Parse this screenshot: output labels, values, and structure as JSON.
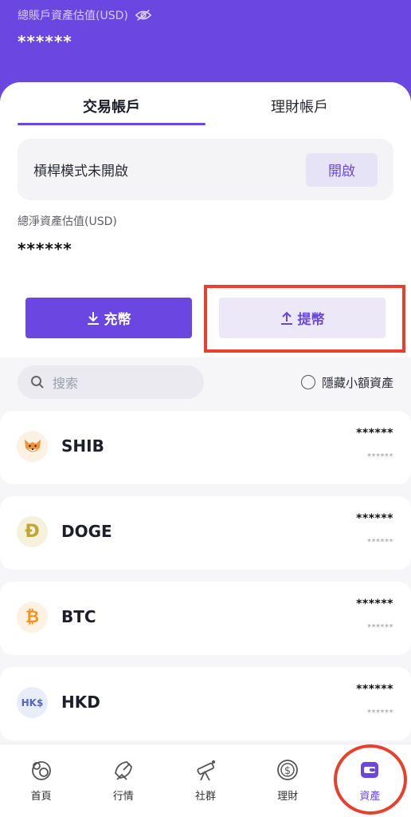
{
  "header": {
    "total_label": "總賬戶資產估值(USD)",
    "total_value": "******",
    "eye_icon": "eye-slash-icon"
  },
  "tabs": [
    {
      "label": "交易帳戶",
      "active": true
    },
    {
      "label": "理財帳戶",
      "active": false
    }
  ],
  "leverage": {
    "text": "槓桿模式未開啟",
    "button": "開啟"
  },
  "net": {
    "label": "總淨資產估值(USD)",
    "value": "******"
  },
  "actions": {
    "deposit": "充幣",
    "withdraw": "提幣"
  },
  "search": {
    "placeholder": "搜索",
    "hide_small": "隱藏小額資產"
  },
  "assets": [
    {
      "name": "SHIB",
      "amount": "******",
      "sub": "******",
      "icon": "shib-icon"
    },
    {
      "name": "DOGE",
      "amount": "******",
      "sub": "******",
      "icon": "doge-icon"
    },
    {
      "name": "BTC",
      "amount": "******",
      "sub": "******",
      "icon": "btc-icon"
    },
    {
      "name": "HKD",
      "amount": "******",
      "sub": "******",
      "icon": "hkd-icon"
    }
  ],
  "nav": [
    {
      "label": "首頁",
      "icon": "home-icon"
    },
    {
      "label": "行情",
      "icon": "satellite-icon"
    },
    {
      "label": "社群",
      "icon": "telescope-icon"
    },
    {
      "label": "理財",
      "icon": "dollar-coin-icon"
    },
    {
      "label": "資產",
      "icon": "wallet-icon",
      "active": true
    }
  ],
  "colors": {
    "accent": "#6b46e0",
    "highlight": "#e8402c"
  }
}
